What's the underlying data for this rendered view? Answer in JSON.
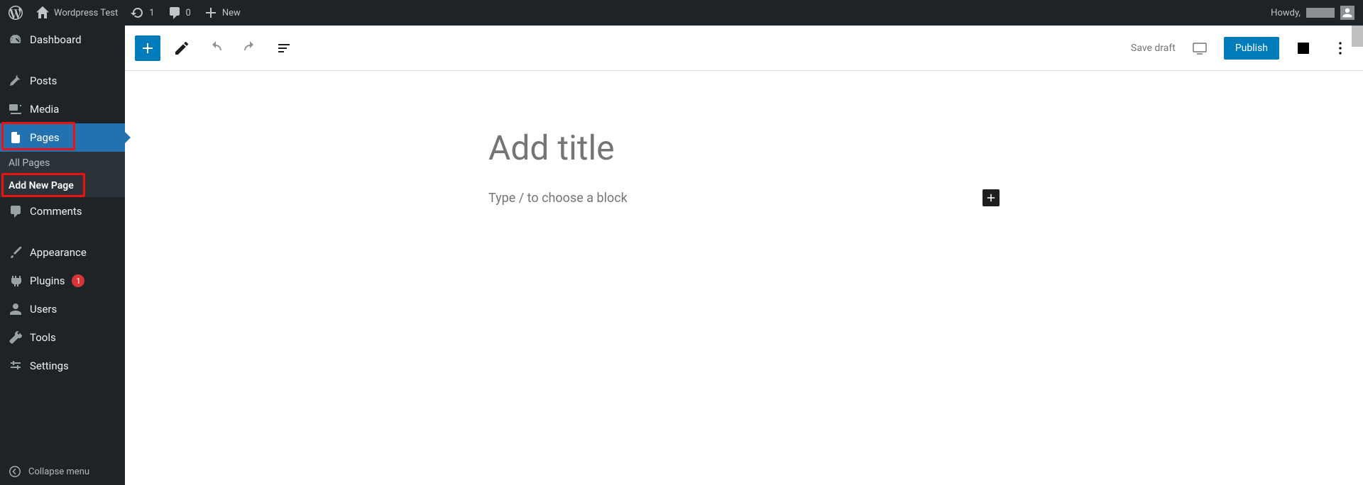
{
  "adminBar": {
    "siteTitle": "Wordpress Test",
    "updates": "1",
    "comments": "0",
    "newLabel": "New",
    "greeting": "Howdy,"
  },
  "sidebar": {
    "dashboard": "Dashboard",
    "posts": "Posts",
    "media": "Media",
    "pages": "Pages",
    "pagesSub": {
      "all": "All Pages",
      "addNew": "Add New Page"
    },
    "comments": "Comments",
    "appearance": "Appearance",
    "plugins": "Plugins",
    "pluginsBadge": "1",
    "users": "Users",
    "tools": "Tools",
    "settings": "Settings",
    "collapse": "Collapse menu"
  },
  "editor": {
    "saveDraft": "Save draft",
    "publish": "Publish",
    "titlePlaceholder": "Add title",
    "blockPlaceholder": "Type / to choose a block"
  }
}
